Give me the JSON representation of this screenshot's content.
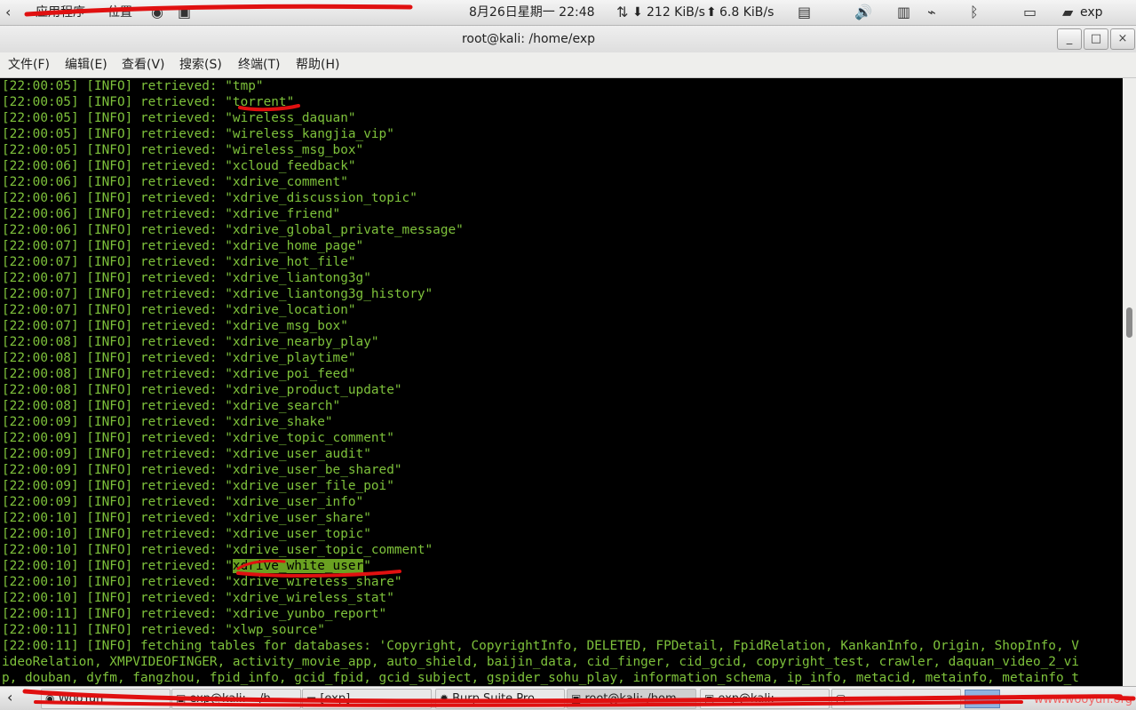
{
  "top_panel": {
    "back_arrow_icon": "chevron-left-icon",
    "applications": "应用程序",
    "places": "位置",
    "clock": "8月26日星期一 22:48",
    "download_rate": "212 KiB/s",
    "upload_rate": "6.8 KiB/s",
    "user": "exp"
  },
  "window": {
    "title": "root@kali: /home/exp",
    "minimize": "_",
    "maximize": "□",
    "close": "×"
  },
  "menubar": [
    "文件(F)",
    "编辑(E)",
    "查看(V)",
    "搜索(S)",
    "终端(T)",
    "帮助(H)"
  ],
  "terminal": {
    "lines": [
      {
        "ts": "[22:00:05]",
        "msg": " [INFO] retrieved: \"tmp\""
      },
      {
        "ts": "[22:00:05]",
        "msg": " [INFO] retrieved: \"torrent\""
      },
      {
        "ts": "[22:00:05]",
        "msg": " [INFO] retrieved: \"wireless_daquan\""
      },
      {
        "ts": "[22:00:05]",
        "msg": " [INFO] retrieved: \"wireless_kangjia_vip\""
      },
      {
        "ts": "[22:00:05]",
        "msg": " [INFO] retrieved: \"wireless_msg_box\""
      },
      {
        "ts": "[22:00:06]",
        "msg": " [INFO] retrieved: \"xcloud_feedback\""
      },
      {
        "ts": "[22:00:06]",
        "msg": " [INFO] retrieved: \"xdrive_comment\""
      },
      {
        "ts": "[22:00:06]",
        "msg": " [INFO] retrieved: \"xdrive_discussion_topic\""
      },
      {
        "ts": "[22:00:06]",
        "msg": " [INFO] retrieved: \"xdrive_friend\""
      },
      {
        "ts": "[22:00:06]",
        "msg": " [INFO] retrieved: \"xdrive_global_private_message\""
      },
      {
        "ts": "[22:00:07]",
        "msg": " [INFO] retrieved: \"xdrive_home_page\""
      },
      {
        "ts": "[22:00:07]",
        "msg": " [INFO] retrieved: \"xdrive_hot_file\""
      },
      {
        "ts": "[22:00:07]",
        "msg": " [INFO] retrieved: \"xdrive_liantong3g\""
      },
      {
        "ts": "[22:00:07]",
        "msg": " [INFO] retrieved: \"xdrive_liantong3g_history\""
      },
      {
        "ts": "[22:00:07]",
        "msg": " [INFO] retrieved: \"xdrive_location\""
      },
      {
        "ts": "[22:00:07]",
        "msg": " [INFO] retrieved: \"xdrive_msg_box\""
      },
      {
        "ts": "[22:00:08]",
        "msg": " [INFO] retrieved: \"xdrive_nearby_play\""
      },
      {
        "ts": "[22:00:08]",
        "msg": " [INFO] retrieved: \"xdrive_playtime\""
      },
      {
        "ts": "[22:00:08]",
        "msg": " [INFO] retrieved: \"xdrive_poi_feed\""
      },
      {
        "ts": "[22:00:08]",
        "msg": " [INFO] retrieved: \"xdrive_product_update\""
      },
      {
        "ts": "[22:00:08]",
        "msg": " [INFO] retrieved: \"xdrive_search\""
      },
      {
        "ts": "[22:00:09]",
        "msg": " [INFO] retrieved: \"xdrive_shake\""
      },
      {
        "ts": "[22:00:09]",
        "msg": " [INFO] retrieved: \"xdrive_topic_comment\""
      },
      {
        "ts": "[22:00:09]",
        "msg": " [INFO] retrieved: \"xdrive_user_audit\""
      },
      {
        "ts": "[22:00:09]",
        "msg": " [INFO] retrieved: \"xdrive_user_be_shared\""
      },
      {
        "ts": "[22:00:09]",
        "msg": " [INFO] retrieved: \"xdrive_user_file_poi\""
      },
      {
        "ts": "[22:00:09]",
        "msg": " [INFO] retrieved: \"xdrive_user_info\""
      },
      {
        "ts": "[22:00:10]",
        "msg": " [INFO] retrieved: \"xdrive_user_share\""
      },
      {
        "ts": "[22:00:10]",
        "msg": " [INFO] retrieved: \"xdrive_user_topic\""
      },
      {
        "ts": "[22:00:10]",
        "msg": " [INFO] retrieved: \"xdrive_user_topic_comment\""
      },
      {
        "ts": "[22:00:10]",
        "msg": " [INFO] retrieved: \"",
        "hl": "xdrive_white_user",
        "tail": "\""
      },
      {
        "ts": "[22:00:10]",
        "msg": " [INFO] retrieved: \"xdrive_wireless_share\""
      },
      {
        "ts": "[22:00:10]",
        "msg": " [INFO] retrieved: \"xdrive_wireless_stat\""
      },
      {
        "ts": "[22:00:11]",
        "msg": " [INFO] retrieved: \"xdrive_yunbo_report\""
      },
      {
        "ts": "[22:00:11]",
        "msg": " [INFO] retrieved: \"xlwp_source\""
      },
      {
        "ts": "[22:00:11]",
        "msg": " [INFO] fetching tables for databases: 'Copyright, CopyrightInfo, DELETED, FPDetail, FpidRelation, KankanInfo, Origin, ShopInfo, V"
      },
      {
        "ts": "",
        "msg": "ideoRelation, XMPVIDEOFINGER, activity_movie_app, auto_shield, baijin_data, cid_finger, cid_gcid, copyright_test, crawler, daquan_video_2_vi"
      },
      {
        "ts": "",
        "msg": "p, douban, dyfm, fangzhou, fpid_info, gcid_fpid, gcid_subject, gspider_sohu_play, information_schema, ip_info, metacid, metainfo, metainfo_t"
      }
    ]
  },
  "taskbar": {
    "tasks": [
      {
        "label": "WooYun",
        "icon": "browser-icon"
      },
      {
        "label": "exp@kali: ~/b...",
        "icon": "terminal-icon"
      },
      {
        "label": "[exp]",
        "icon": "folder-icon"
      },
      {
        "label": "Burp Suite Pro...",
        "icon": "burp-icon"
      },
      {
        "label": "root@kali: /hom...",
        "icon": "terminal-icon"
      },
      {
        "label": "exp@kali: ~",
        "icon": "terminal-icon"
      },
      {
        "label": "",
        "icon": "window-icon"
      }
    ],
    "watermark": "www.wooyun.org"
  }
}
